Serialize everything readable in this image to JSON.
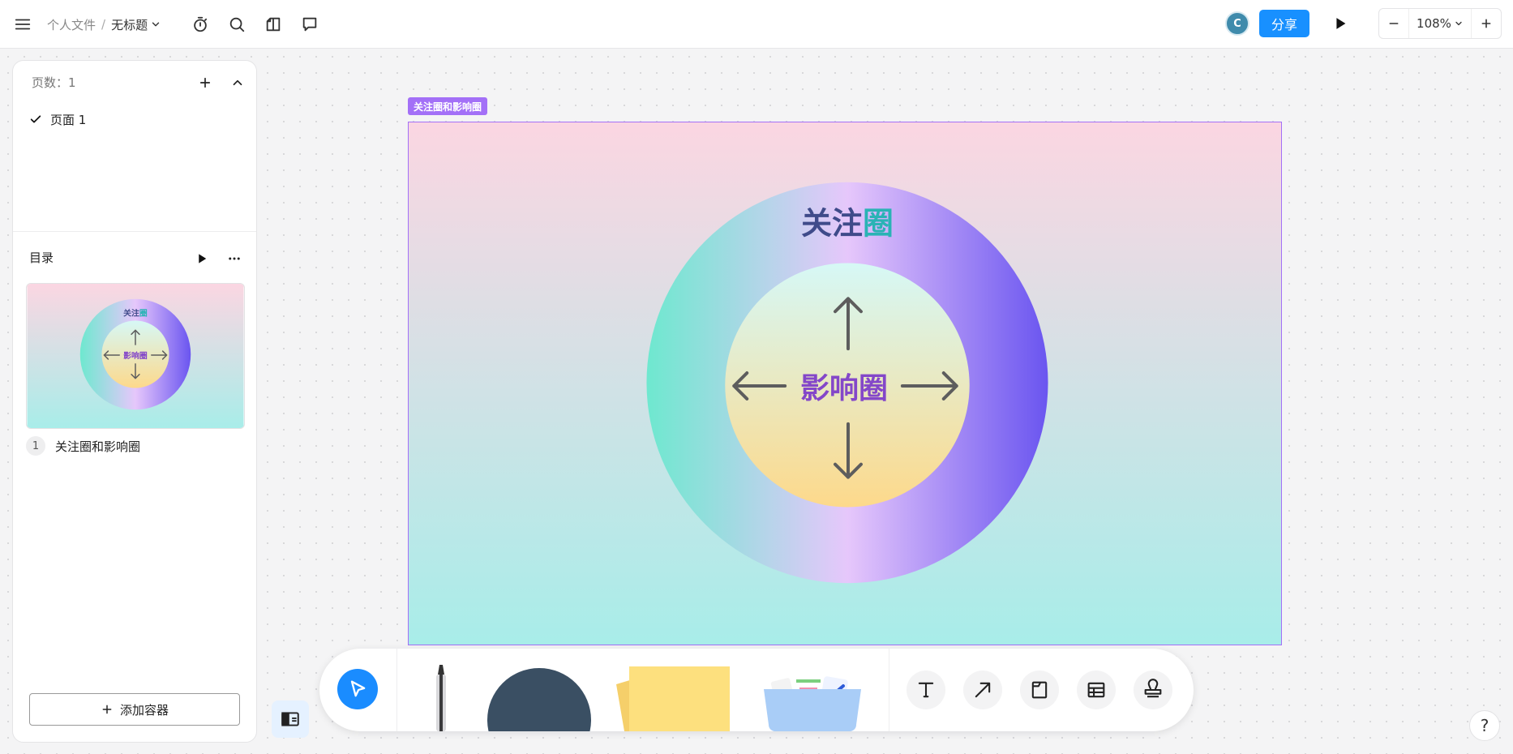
{
  "header": {
    "breadcrumb_parent": "个人文件",
    "breadcrumb_separator": "/",
    "doc_title": "无标题",
    "avatar_initial": "C",
    "share_label": "分享",
    "zoom_value": "108%"
  },
  "pages_panel": {
    "title": "页数：1",
    "pages": [
      {
        "label": "页面 1",
        "selected": true
      }
    ]
  },
  "toc_panel": {
    "title": "目录",
    "items": [
      {
        "number": "1",
        "label": "关注圈和影响圈"
      }
    ],
    "add_container_label": "添加容器"
  },
  "canvas": {
    "frame_label": "关注圈和影响圈",
    "outer_circle_title_part1": "关注",
    "outer_circle_title_part2": "圈",
    "inner_circle_title": "影响圈",
    "colors": {
      "frame_bg_top": "#fbd6e2",
      "frame_bg_bottom": "#a8ede9",
      "ring_left": "#6ee8cf",
      "ring_mid": "#e6c7fb",
      "ring_right": "#6a55f0",
      "inner_top": "#d6f8f6",
      "inner_bottom": "#fdd98b",
      "title_dark": "#3f4b8a",
      "title_teal": "#2ab3b5",
      "inner_title": "#8447c9",
      "arrow": "#5d5d5d",
      "accent": "#a370f7",
      "brand_blue": "#1890ff"
    }
  },
  "toolbar": {
    "tools": [
      "select-tool",
      "pen-tool",
      "shape-tool",
      "sticky-note-tool",
      "sticker-tool",
      "text-tool",
      "connector-tool",
      "container-tool",
      "table-tool",
      "stamp-tool"
    ]
  },
  "help_label": "?"
}
